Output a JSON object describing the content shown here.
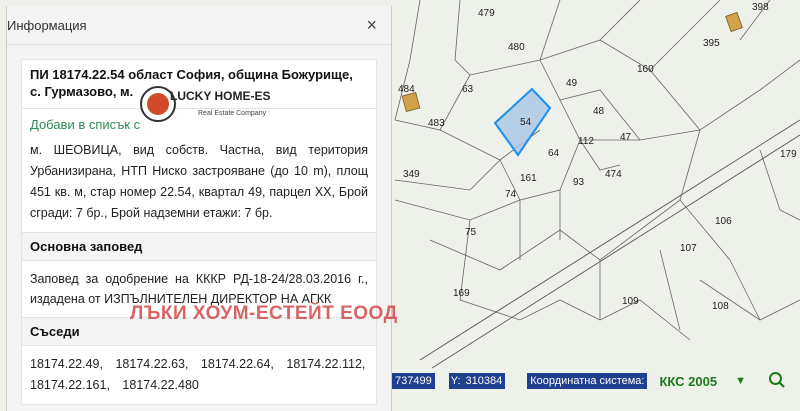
{
  "panel": {
    "title": "Информация",
    "close_glyph": "×",
    "plot_title_line1": "ПИ 18174.22.54 област София, община Божурище,",
    "plot_title_line2": "с. Гурмазово, м.",
    "add_link": "Добави в списък с",
    "description": "м. ШЕОВИЦА, вид собств. Частна, вид територия Урбанизирана, НТП Ниско застрояване (до 10 m), площ 451 кв. м, стар номер 22.54, квартал 49, парцел XX, Брой сгради: 7 бр., Брой надземни етажи: 7 бр.",
    "order_heading": "Основна заповед",
    "order_text": "Заповед за одобрение на КККР РД-18-24/28.03.2016 г., издадена от ИЗПЪЛНИТЕЛЕН ДИРЕКТОР НА АГКК",
    "neighbors_heading": "Съседи",
    "neighbors_line1": "18174.22.49, 18174.22.63, 18174.22.64, 18174.22.112,",
    "neighbors_line2": "18174.22.161, 18174.22.480"
  },
  "logo": {
    "top_text": "LUCKY HOME-ESTATE",
    "sub_text": "Real Estate Company"
  },
  "watermark": "ЛЪКИ ХОУМ-ЕСТЕЙТ ЕООД",
  "coords": {
    "x_value": "737499",
    "y_label": "Y:",
    "y_value": "310384",
    "system_label": "Координатна система:",
    "system_value": "ККС 2005"
  },
  "map": {
    "selected_plot_color": "#9fc4e8",
    "plot_labels": [
      "479",
      "398",
      "480",
      "395",
      "160",
      "49",
      "48",
      "63",
      "484",
      "483",
      "54",
      "112",
      "47",
      "64",
      "179",
      "349",
      "161",
      "93",
      "474",
      "74",
      "106",
      "75",
      "107",
      "169",
      "109",
      "108"
    ]
  },
  "icons": {
    "close": "close-icon",
    "dropdown": "chevron-down-icon",
    "search": "search-icon"
  }
}
